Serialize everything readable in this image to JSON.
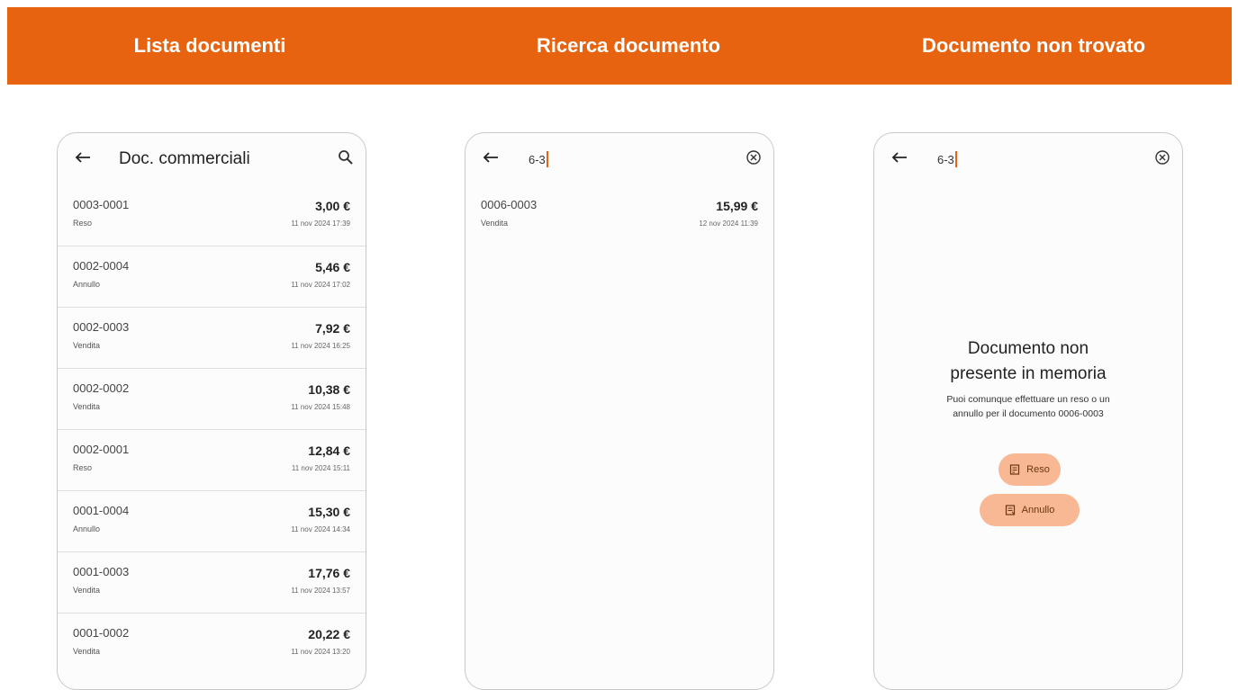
{
  "header": {
    "titles": [
      "Lista documenti",
      "Ricerca documento",
      "Documento non trovato"
    ]
  },
  "screen_list": {
    "title": "Doc. commerciali",
    "items": [
      {
        "number": "0003-0001",
        "type": "Reso",
        "amount": "3,00 €",
        "date": "11 nov 2024 17:39"
      },
      {
        "number": "0002-0004",
        "type": "Annullo",
        "amount": "5,46 €",
        "date": "11 nov 2024 17:02"
      },
      {
        "number": "0002-0003",
        "type": "Vendita",
        "amount": "7,92 €",
        "date": "11 nov 2024 16:25"
      },
      {
        "number": "0002-0002",
        "type": "Vendita",
        "amount": "10,38 €",
        "date": "11 nov 2024 15:48"
      },
      {
        "number": "0002-0001",
        "type": "Reso",
        "amount": "12,84 €",
        "date": "11 nov 2024 15:11"
      },
      {
        "number": "0001-0004",
        "type": "Annullo",
        "amount": "15,30 €",
        "date": "11 nov 2024 14:34"
      },
      {
        "number": "0001-0003",
        "type": "Vendita",
        "amount": "17,76 €",
        "date": "11 nov 2024 13:57"
      },
      {
        "number": "0001-0002",
        "type": "Vendita",
        "amount": "20,22 €",
        "date": "11 nov 2024 13:20"
      }
    ]
  },
  "screen_search": {
    "query": "6-3",
    "results": [
      {
        "number": "0006-0003",
        "type": "Vendita",
        "amount": "15,99 €",
        "date": "12 nov 2024 11:39"
      }
    ]
  },
  "screen_notfound": {
    "query": "6-3",
    "title_line1": "Documento non",
    "title_line2": "presente in memoria",
    "message_line1": "Puoi comunque effettuare un reso o un",
    "message_line2": "annullo per il documento 0006-0003",
    "button_reso": "Reso",
    "button_annullo": "Annullo"
  },
  "colors": {
    "accent": "#e8630f",
    "pill": "#f7b893"
  },
  "icons": {
    "back": "arrow-left-icon",
    "search": "search-icon",
    "clear": "clear-circle-icon",
    "receipt": "receipt-icon"
  }
}
